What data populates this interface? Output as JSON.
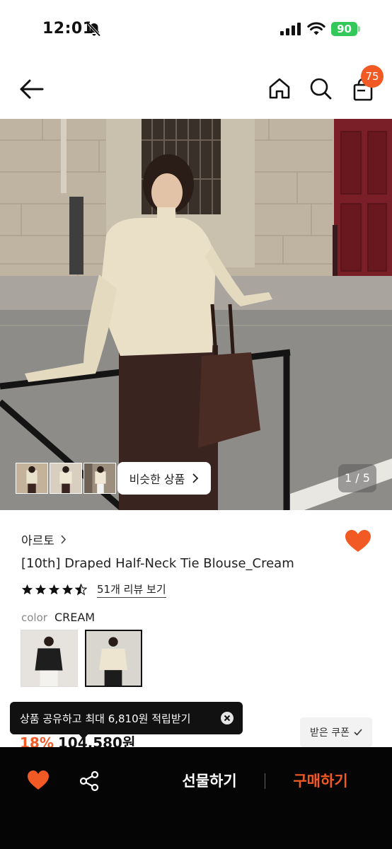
{
  "status_bar": {
    "time": "12:01",
    "battery": "90"
  },
  "nav": {
    "cart_count": "75"
  },
  "gallery": {
    "similar_label": "비슷한 상품",
    "page_indicator": "1 / 5"
  },
  "product": {
    "brand": "아르토",
    "title": "[10th] Draped Half-Neck Tie Blouse_Cream",
    "rating": 4.5,
    "review_link": "51개 리뷰 보기",
    "color_label": "color",
    "color_value": "CREAM",
    "discount": "18%",
    "price": "104,580원"
  },
  "toast": {
    "text": "상품 공유하고 최대 6,810원 적립받기"
  },
  "coupon": {
    "label": "받은 쿠폰"
  },
  "bottom_bar": {
    "gift_label": "선물하기",
    "buy_label": "구매하기"
  },
  "colors": {
    "accent": "#f15a24",
    "bottom_bar_bg": "#050505",
    "battery": "#34c759"
  }
}
